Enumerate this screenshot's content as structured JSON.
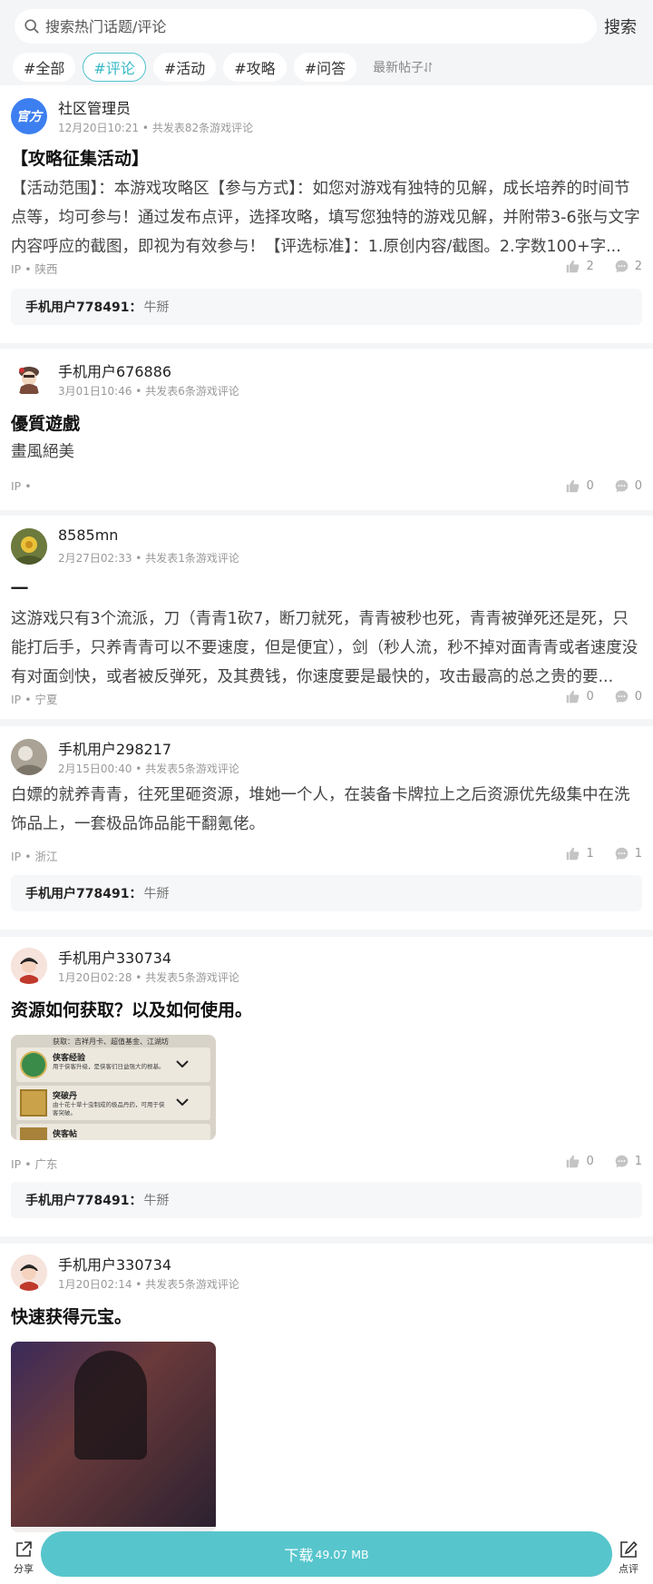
{
  "search": {
    "placeholder": "搜索热门话题/评论",
    "button": "搜索"
  },
  "tabs": [
    {
      "label": "#全部",
      "active": false
    },
    {
      "label": "#评论",
      "active": true
    },
    {
      "label": "#活动",
      "active": false
    },
    {
      "label": "#攻略",
      "active": false
    },
    {
      "label": "#问答",
      "active": false
    }
  ],
  "sort": {
    "label": "最新帖子",
    "icon": "sort-arrows-icon"
  },
  "posts": [
    {
      "user": "社区管理员",
      "avatar_badge": "官方",
      "meta": "12月20日10:21 • 共发表82条游戏评论",
      "title": "【攻略征集活动】",
      "body": "【活动范围】：本游戏攻略区【参与方式】：如您对游戏有独特的见解，成长培养的时间节点等，均可参与！通过发布点评，选择攻略，填写您独特的游戏见解，并附带3-6张与文字内容呼应的截图，即视为有效参与！【评选标准】：1.原创内容/截图。2.字数100+字...",
      "ip": "IP • 陕西",
      "likes": "2",
      "comments": "2",
      "reply": {
        "user": "手机用户778491：",
        "text": "牛掰"
      }
    },
    {
      "user": "手机用户676886",
      "meta": "3月01日10:46 • 共发表6条游戏评论",
      "title": "優質遊戲",
      "body": "畫風絕美",
      "ip": "IP •",
      "likes": "0",
      "comments": "0"
    },
    {
      "user": "8585mn",
      "meta": "2月27日02:33 • 共发表1条游戏评论",
      "title": "一",
      "body": "这游戏只有3个流派，刀（青青1砍7，断刀就死，青青被秒也死，青青被弹死还是死，只能打后手，只养青青可以不要速度，但是便宜），剑（秒人流，秒不掉对面青青或者速度没有对面剑快，或者被反弹死，及其费钱，你速度要是最快的，攻击最高的总之贵的要...",
      "ip": "IP • 宁夏",
      "likes": "0",
      "comments": "0"
    },
    {
      "user": "手机用户298217",
      "meta": "2月15日00:40 • 共发表5条游戏评论",
      "body": "白嫖的就养青青，往死里砸资源，堆她一个人，在装备卡牌拉上之后资源优先级集中在洗饰品上，一套极品饰品能干翻氪佬。",
      "ip": "IP • 浙江",
      "likes": "1",
      "comments": "1",
      "reply": {
        "user": "手机用户778491：",
        "text": "牛掰"
      }
    },
    {
      "user": "手机用户330734",
      "meta": "1月20日02:28 • 共发表5条游戏评论",
      "title": "资源如何获取？以及如何使用。",
      "image": {
        "header": "获取：吉祥月卡、超值基金、江湖坊",
        "items": [
          {
            "name": "侠客经验",
            "desc": "用于侠客升级，是侠客们日益强大的根基。"
          },
          {
            "name": "突破丹",
            "desc": "由十花十草十虫制成的极品丹药，可用于侠客突破。"
          },
          {
            "name": "侠客帖",
            "desc": ""
          }
        ]
      },
      "ip": "IP • 广东",
      "likes": "0",
      "comments": "1",
      "reply": {
        "user": "手机用户778491：",
        "text": "牛掰"
      }
    },
    {
      "user": "手机用户330734",
      "meta": "1月20日02:14 • 共发表5条游戏评论",
      "title": "快速获得元宝。"
    }
  ],
  "bottom": {
    "share": "分享",
    "download": "下载",
    "size": "49.07 MB",
    "review": "点评"
  },
  "colors": {
    "accent": "#57c5cc",
    "tab_active": "#36b8c4",
    "official_badge": "#3d7ff0"
  }
}
